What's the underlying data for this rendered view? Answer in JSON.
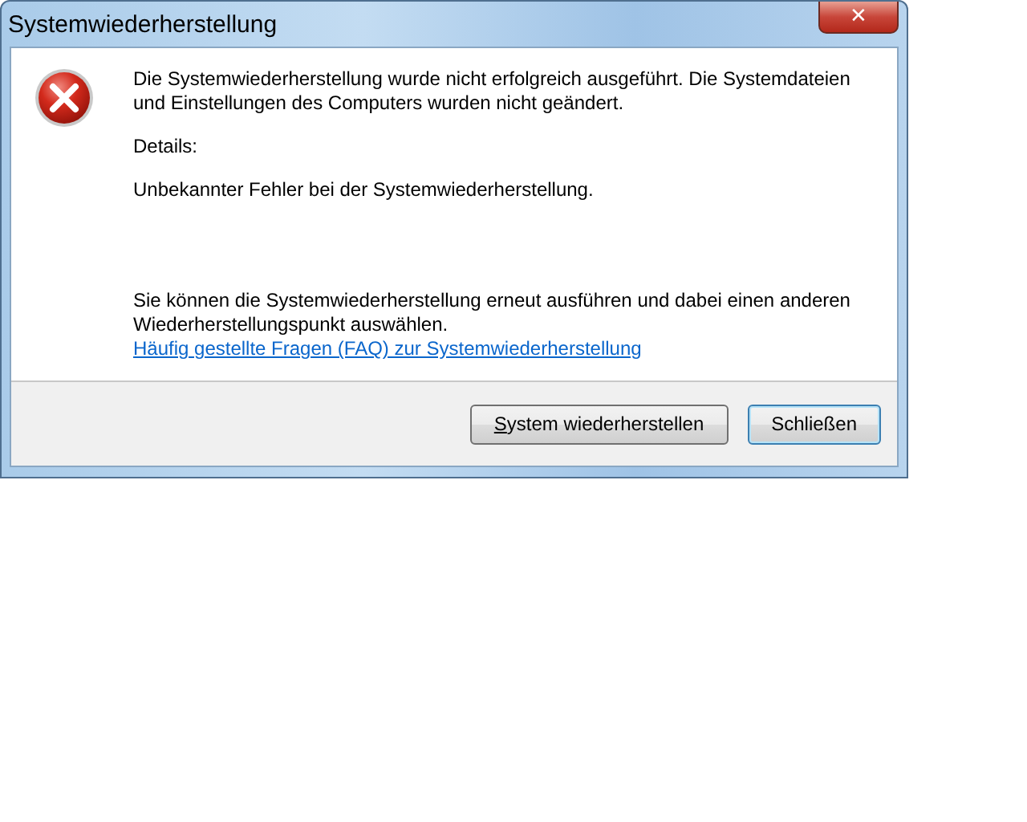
{
  "window": {
    "title": "Systemwiederherstellung",
    "close_label": "✕"
  },
  "message": {
    "kind": "error",
    "main": "Die Systemwiederherstellung wurde nicht erfolgreich ausgeführt. Die Systemdateien und Einstellungen des Computers wurden nicht geändert.",
    "details_label": "Details:",
    "details": "Unbekannter Fehler bei der Systemwiederherstellung.",
    "hint": "Sie können die Systemwiederherstellung erneut ausführen und dabei einen anderen Wiederherstellungspunkt auswählen.",
    "link": "Häufig gestellte Fragen (FAQ) zur Systemwiederherstellung"
  },
  "buttons": [
    {
      "label": "System wiederherstellen",
      "default": false
    },
    {
      "label": "Schließen",
      "default": true
    }
  ]
}
